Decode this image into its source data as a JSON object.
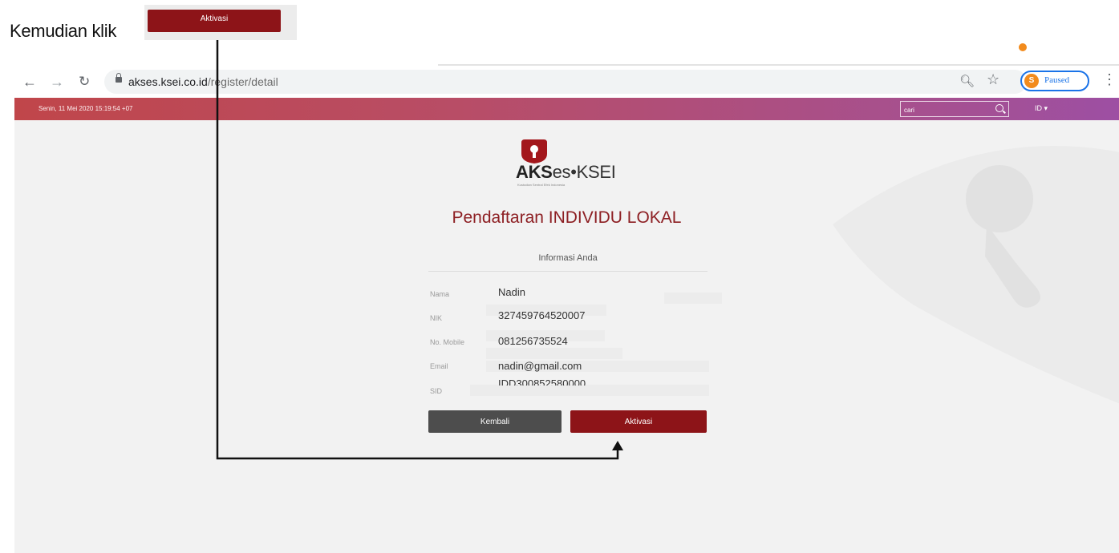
{
  "instruction": {
    "text": "Kemudian klik",
    "button_label": "Aktivasi"
  },
  "browser": {
    "url_host": "akses.ksei.co.id",
    "url_path": "/register/detail",
    "profile_initial": "S",
    "profile_status": "Paused"
  },
  "site_header": {
    "datetime": "Senin, 11 Mei 2020 15:19:54 +07",
    "search_placeholder": "cari",
    "language": "ID ▾"
  },
  "logo": {
    "brand_bold": "AKS",
    "brand_rest": "es•KSEI",
    "tagline": "Kustodian Sentral Efek Indonesia"
  },
  "form": {
    "title": "Pendaftaran INDIVIDU LOKAL",
    "section_title": "Informasi Anda",
    "fields": [
      {
        "label": "Nama",
        "value": "Nadin"
      },
      {
        "label": "NIK",
        "value": "327459764520007"
      },
      {
        "label": "No. Mobile",
        "value": "081256735524"
      },
      {
        "label": "Email",
        "value": "nadin@gmail.com"
      },
      {
        "label": "SID",
        "value": "IDD300852580000"
      }
    ],
    "back_label": "Kembali",
    "activate_label": "Aktivasi"
  },
  "colors": {
    "brand_red": "#8d1418",
    "header_start": "#c0464a",
    "header_end": "#9d4fa3",
    "back_button": "#4d4d4d",
    "profile_orange": "#f28b1d",
    "profile_blue": "#1a73e8"
  }
}
